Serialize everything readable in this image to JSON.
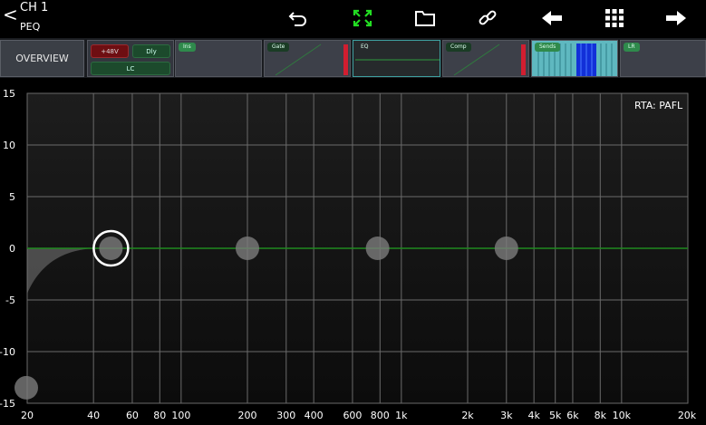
{
  "header": {
    "back_glyph": "<",
    "channel_name": "CH 1",
    "page_name": "PEQ",
    "icons": [
      {
        "name": "undo-icon",
        "color": "#ffffff"
      },
      {
        "name": "expand-icon",
        "color": "#22dd22"
      },
      {
        "name": "folder-icon",
        "color": "#ffffff"
      },
      {
        "name": "link-icon",
        "color": "#ffffff"
      },
      {
        "name": "arrow-left-icon",
        "color": "#ffffff"
      },
      {
        "name": "grid-icon",
        "color": "#ffffff"
      },
      {
        "name": "arrow-right-icon",
        "color": "#ffffff"
      }
    ]
  },
  "strip": {
    "overview_label": "OVERVIEW",
    "input": {
      "phantom_label": "+48V",
      "dly_label": "Dly",
      "lc_label": "LC"
    },
    "ins_label": "Ins",
    "gate_label": "Gate",
    "eq_label": "EQ",
    "comp_label": "Comp",
    "sends_label": "Sends",
    "lr_label": "LR"
  },
  "graph": {
    "rta_label": "RTA: PAFL",
    "y_ticks": [
      "15",
      "10",
      "5",
      "0",
      "-5",
      "-10",
      "-15"
    ],
    "y_values": [
      15,
      10,
      5,
      0,
      -5,
      -10,
      -15
    ],
    "x_ticks": [
      "20",
      "40",
      "60",
      "80",
      "100",
      "200",
      "300",
      "400",
      "600",
      "800",
      "1k",
      "2k",
      "3k",
      "4k",
      "5k",
      "6k",
      "8k",
      "10k",
      "20k"
    ],
    "x_values": [
      20,
      40,
      60,
      80,
      100,
      200,
      300,
      400,
      600,
      800,
      1000,
      2000,
      3000,
      4000,
      5000,
      6000,
      8000,
      10000,
      20000
    ],
    "x_range": [
      20,
      20000
    ],
    "y_range": [
      -15,
      15
    ],
    "curve_color": "#1e8a1e",
    "bands": [
      {
        "freq": 20,
        "gain": -13.5,
        "selected": false
      },
      {
        "freq": 48,
        "gain": 0,
        "selected": true
      },
      {
        "freq": 200,
        "gain": 0,
        "selected": false
      },
      {
        "freq": 780,
        "gain": 0,
        "selected": false
      },
      {
        "freq": 3000,
        "gain": 0,
        "selected": false
      }
    ]
  }
}
